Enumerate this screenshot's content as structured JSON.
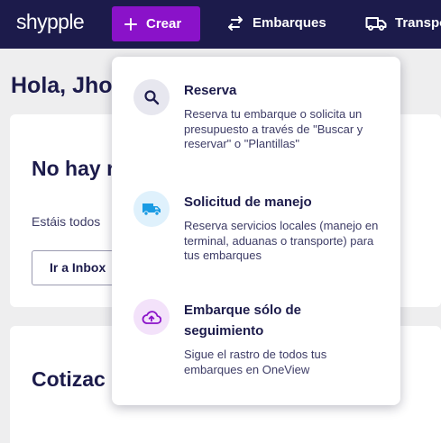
{
  "header": {
    "logo": "shypple",
    "crear_label": "Crear",
    "nav": [
      {
        "label": "Embarques"
      },
      {
        "label": "Transpo"
      }
    ]
  },
  "main": {
    "greeting": "Hola, Jho",
    "card1": {
      "title": "No hay r",
      "text": "Estáis todos",
      "button": "Ir a Inbox"
    },
    "card2": {
      "title": "Cotizac"
    }
  },
  "dropdown": {
    "items": [
      {
        "title": "Reserva",
        "description": "Reserva tu embarque o solicita un presupuesto a través de \"Buscar y reservar\" o \"Plantillas\""
      },
      {
        "title": "Solicitud de manejo",
        "description": "Reserva servicios locales (manejo en terminal, aduanas o transporte) para tus embarques"
      },
      {
        "title": "Embarque sólo de seguimiento",
        "description": "Sigue el rastro de todos tus embarques en OneView"
      }
    ]
  },
  "colors": {
    "header_bg": "#1c1b4b",
    "accent": "#8a12c9",
    "page_bg": "#eeeeef",
    "text_dark": "#1c1b4b"
  },
  "icons": [
    "plus-icon",
    "swap-arrows-icon",
    "truck-icon",
    "search-icon",
    "cloud-upload-icon"
  ]
}
